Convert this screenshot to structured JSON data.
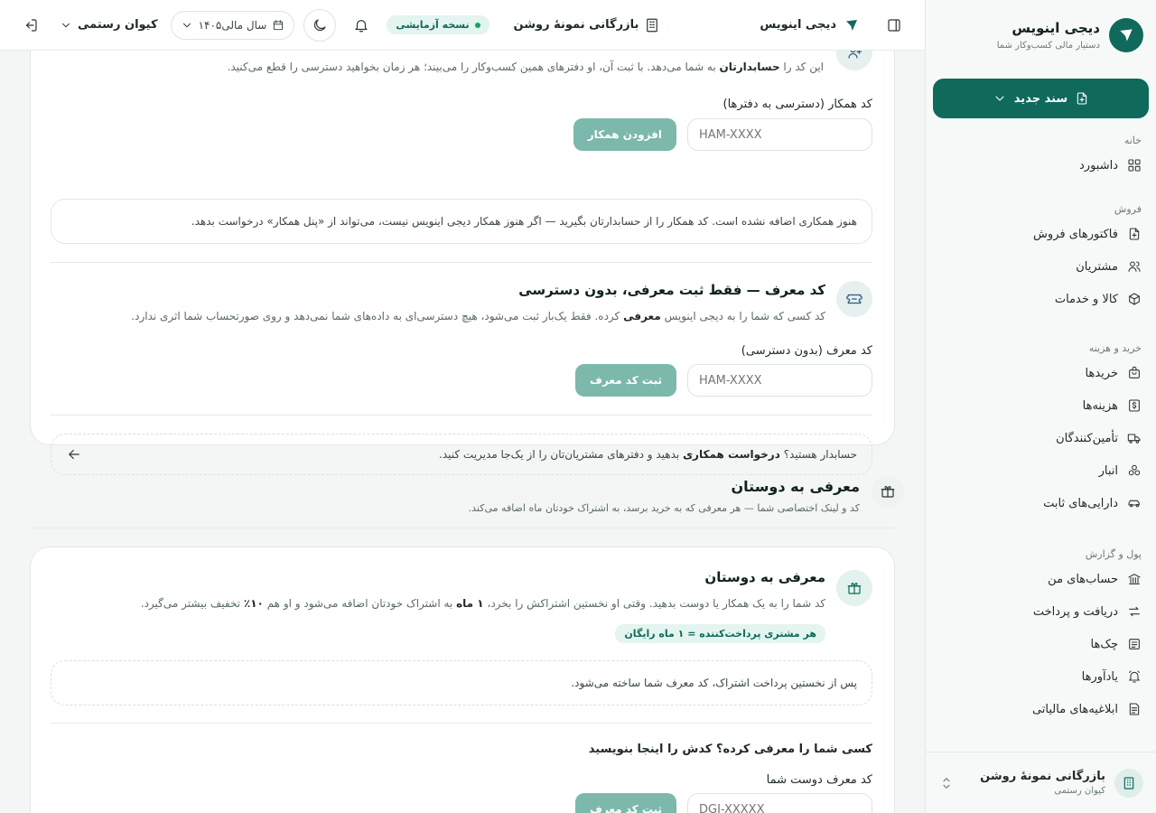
{
  "sidebar": {
    "brand_name": "دیجی اینویس",
    "brand_sub": "دستیار مالی کسب‌وکار شما",
    "new_doc_label": "سند جدید",
    "sections": [
      {
        "title": "خانه",
        "items": [
          {
            "label": "داشبورد",
            "icon": "dashboard-icon"
          }
        ]
      },
      {
        "title": "فروش",
        "items": [
          {
            "label": "فاکتورهای فروش",
            "icon": "invoice-icon"
          },
          {
            "label": "مشتریان",
            "icon": "users-icon"
          },
          {
            "label": "کالا و خدمات",
            "icon": "box-icon"
          }
        ]
      },
      {
        "title": "خرید و هزینه",
        "items": [
          {
            "label": "خریدها",
            "icon": "shopping-bag-icon"
          },
          {
            "label": "هزینه‌ها",
            "icon": "dollar-icon"
          },
          {
            "label": "تأمین‌کنندگان",
            "icon": "truck-icon"
          },
          {
            "label": "انبار",
            "icon": "boxes-icon"
          },
          {
            "label": "دارایی‌های ثابت",
            "icon": "car-icon"
          }
        ]
      },
      {
        "title": "پول و گزارش",
        "items": [
          {
            "label": "حساب‌های من",
            "icon": "bank-icon"
          },
          {
            "label": "دریافت و پرداخت",
            "icon": "transfer-icon"
          },
          {
            "label": "چک‌ها",
            "icon": "check-icon"
          },
          {
            "label": "یادآورها",
            "icon": "alarm-icon"
          },
          {
            "label": "ابلاغیه‌های مالیاتی",
            "icon": "notice-icon"
          }
        ]
      }
    ],
    "footer": {
      "company": "بازرگانی نمونهٔ روشن",
      "user": "کیوان رستمی"
    }
  },
  "topbar": {
    "brand": "دیجی اینویس",
    "company": "بازرگانی نمونهٔ روشن",
    "trial_badge": "نسخه آزمایشی",
    "fiscal_year": "سال مالی۱۴۰۵",
    "user_name": "کیوان رستمی"
  },
  "collab": {
    "intro_text_pre": "این کد را",
    "intro_bold": "حسابدارتان",
    "intro_text_post": "به شما می‌دهد. با ثبت آن، او دفترهای همین کسب‌وکار را می‌بیند؛ هر زمان بخواهید دسترسی را قطع می‌کنید.",
    "field_label": "کد همکار (دسترسی به دفترها)",
    "placeholder": "HAM-XXXX",
    "button": "افزودن همکار",
    "empty_note": "هنوز همکاری اضافه نشده است. کد همکار را از حسابدارتان بگیرید — اگر هنوز همکار دیجی اینویس نیست، می‌تواند از «پنل همکار» درخواست بدهد."
  },
  "referrer": {
    "title": "کد معرف — فقط ثبت معرفی، بدون دسترسی",
    "desc_pre": "کد کسی که شما را به دیجی اینویس",
    "desc_bold": "معرفی",
    "desc_post": "کرده. فقط یک‌بار ثبت می‌شود، هیچ دسترسی‌ای به داده‌های شما نمی‌دهد و روی صورتحساب شما اثری ندارد.",
    "field_label": "کد معرف (بدون دسترسی)",
    "placeholder": "HAM-XXXX",
    "button": "ثبت کد معرف",
    "accountant_pre": "حسابدار هستید؟",
    "accountant_bold": "درخواست همکاری",
    "accountant_post": "بدهید و دفترهای مشتریان‌تان را از یک‌جا مدیریت کنید."
  },
  "invite_section": {
    "title": "معرفی به دوستان",
    "subtitle": "کد و لینک اختصاصی شما — هر معرفی که به خرید برسد، به اشتراک خودتان ماه اضافه می‌کند."
  },
  "invite_card": {
    "title": "معرفی به دوستان",
    "desc_pre": "کد شما را به یک همکار یا دوست بدهید. وقتی او نخستین اشتراکش را بخرد،",
    "desc_bold1": "۱ ماه",
    "desc_mid": "به اشتراک خودتان اضافه می‌شود و او هم",
    "desc_bold2": "۱۰٪",
    "desc_post": "تخفیف بیشتر می‌گیرد.",
    "reward_badge": "هر مشتری پرداخت‌کننده = ۱ ماه رایگان",
    "pending_note": "پس از نخستین پرداخت اشتراک، کد معرف شما ساخته می‌شود.",
    "ask_title": "کسی شما را معرفی کرده؟ کدش را اینجا بنویسید",
    "field_label": "کد معرف دوست شما",
    "placeholder": "DGI-XXXXX",
    "button": "ثبت کد معرف"
  },
  "colors": {
    "primary": "#0f6a5b",
    "soft_button": "#7cb8ab",
    "badge_bg": "#e4f4ee"
  }
}
